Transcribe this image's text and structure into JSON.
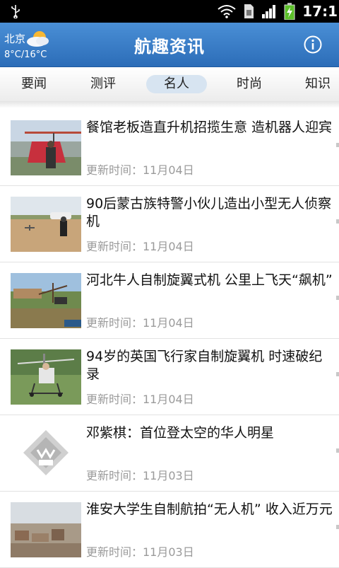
{
  "status_bar": {
    "time": "17:1"
  },
  "header": {
    "city": "北京",
    "temperature": "8°C/16°C",
    "title": "航趣资讯",
    "weather_icon": "partly-cloudy-icon",
    "info_icon": "info-icon"
  },
  "tabs": [
    {
      "label": "要闻",
      "selected": false
    },
    {
      "label": "测评",
      "selected": false
    },
    {
      "label": "名人",
      "selected": true
    },
    {
      "label": "时尚",
      "selected": false
    },
    {
      "label": "知识",
      "selected": false
    }
  ],
  "articles": [
    {
      "title": "餐馆老板造直升机招揽生意 造机器人迎宾",
      "updated": "更新时间：11月04日"
    },
    {
      "title": "90后蒙古族特警小伙儿造出小型无人侦察机",
      "updated": "更新时间：11月04日"
    },
    {
      "title": "河北牛人自制旋翼式机 公里上飞天“飙机”",
      "updated": "更新时间：11月04日"
    },
    {
      "title": "94岁的英国飞行家自制旋翼机 时速破纪录",
      "updated": "更新时间：11月04日"
    },
    {
      "title": "邓紫棋：首位登太空的华人明星",
      "updated": "更新时间：11月03日"
    },
    {
      "title": "淮安大学生自制航拍“无人机” 收入近万元",
      "updated": "更新时间：11月03日"
    }
  ],
  "colors": {
    "header_blue": "#2c6db8",
    "tab_pill": "#d7e4f1"
  }
}
